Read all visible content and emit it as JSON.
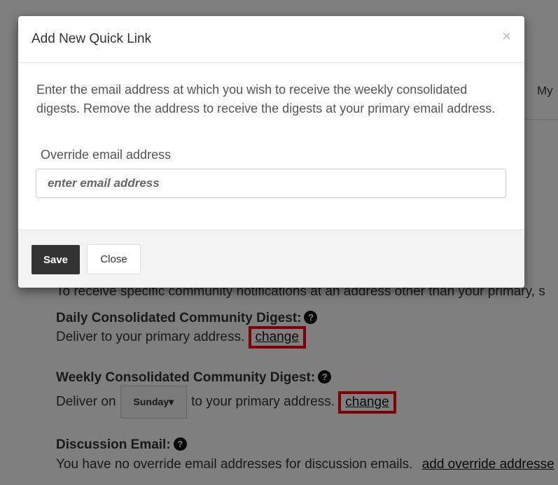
{
  "background": {
    "tab_label": "My",
    "notice_text": "To receive specific community notifications at an address other than your primary, s",
    "daily": {
      "title": "Daily Consolidated Community Digest:",
      "deliver_text": "Deliver to your primary address.",
      "change_label": "change"
    },
    "weekly": {
      "title": "Weekly Consolidated Community Digest:",
      "deliver_prefix": "Deliver on",
      "day_value": "Sunday",
      "deliver_suffix": "to your primary address.",
      "change_label": "change"
    },
    "discussion": {
      "title": "Discussion Email:",
      "text": "You have no override email addresses for discussion emails.",
      "add_label": "add override addresse"
    }
  },
  "modal": {
    "title": "Add New Quick Link",
    "close_symbol": "×",
    "description": "Enter the email address at which you wish to receive the weekly consolidated digests. Remove the address to receive the digests at your primary email address.",
    "field_label": "Override email address",
    "input_placeholder": "enter email address",
    "input_value": "",
    "save_label": "Save",
    "close_label": "Close"
  },
  "colors": {
    "highlight": "#ff0000",
    "save_button": "#333333",
    "overlay": "rgba(0,0,0,0.5)"
  }
}
